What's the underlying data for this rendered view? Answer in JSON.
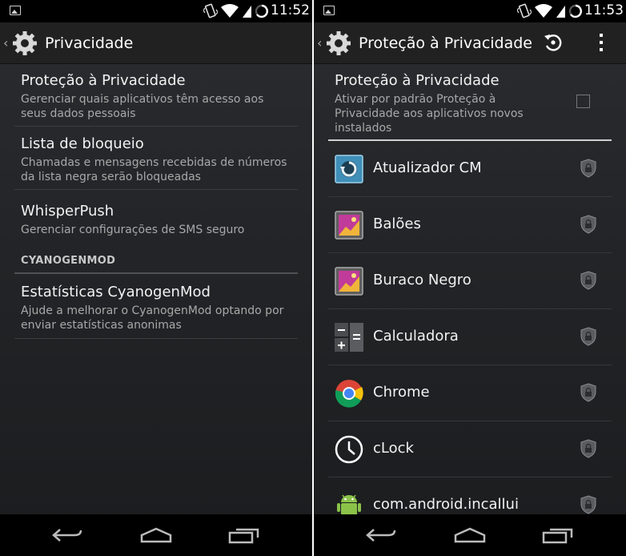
{
  "left": {
    "status": {
      "time": "11:52"
    },
    "actionbar": {
      "title": "Privacidade"
    },
    "prefs": [
      {
        "title": "Proteção à Privacidade",
        "summary1": "Gerenciar quais aplicativos têm acesso aos",
        "summary2": "seus dados pessoais"
      },
      {
        "title": "Lista de bloqueio",
        "summary1": "Chamadas e mensagens recebidas de números",
        "summary2": "da lista negra serão bloqueadas"
      },
      {
        "title": "WhisperPush",
        "summary1": "Gerenciar configurações de SMS seguro",
        "summary2": ""
      }
    ],
    "category": "CYANOGENMOD",
    "stats": {
      "title": "Estatísticas CyanogenMod",
      "summary1": "Ajude a melhorar o CyanogenMod optando por",
      "summary2": "enviar estatísticas anonimas"
    }
  },
  "right": {
    "status": {
      "time": "11:53"
    },
    "actionbar": {
      "title": "Proteção à Privacidade"
    },
    "header": {
      "title": "Proteção à Privacidade",
      "summary1": "Ativar por padrão Proteção à",
      "summary2": "Privacidade aos aplicativos novos",
      "summary3": "instalados",
      "checked": false
    },
    "apps": [
      {
        "name": "Atualizador CM",
        "icon": "cm-updater-icon"
      },
      {
        "name": "Balões",
        "icon": "gallery-icon"
      },
      {
        "name": "Buraco Negro",
        "icon": "gallery-icon"
      },
      {
        "name": "Calculadora",
        "icon": "calculator-icon"
      },
      {
        "name": "Chrome",
        "icon": "chrome-icon"
      },
      {
        "name": "cLock",
        "icon": "clock-icon"
      },
      {
        "name": "com.android.incallui",
        "icon": "android-icon"
      }
    ]
  },
  "colors": {
    "background": "#232528",
    "statusbar": "#000000",
    "accent": "#33b5e5"
  }
}
